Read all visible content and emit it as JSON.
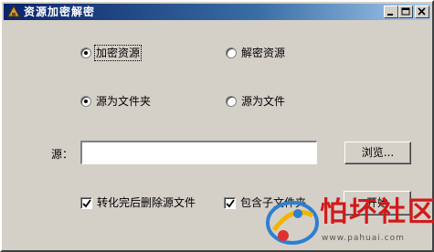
{
  "window": {
    "title": "资源加密解密",
    "icon": "app-icon"
  },
  "mode": {
    "encrypt_label": "加密资源",
    "decrypt_label": "解密资源",
    "selected": "encrypt"
  },
  "source_type": {
    "folder_label": "源为文件夹",
    "file_label": "源为文件",
    "selected": "folder"
  },
  "source": {
    "label": "源：",
    "value": "",
    "browse_label": "浏览..."
  },
  "options": {
    "delete_after_label": "转化完后删除源文件",
    "delete_after_checked": true,
    "include_subfolders_label": "包含子文件夹",
    "include_subfolders_checked": true
  },
  "actions": {
    "start_label": "开始"
  },
  "watermark": {
    "brand": "怕坏社区",
    "url": "www.pahuai.com"
  }
}
